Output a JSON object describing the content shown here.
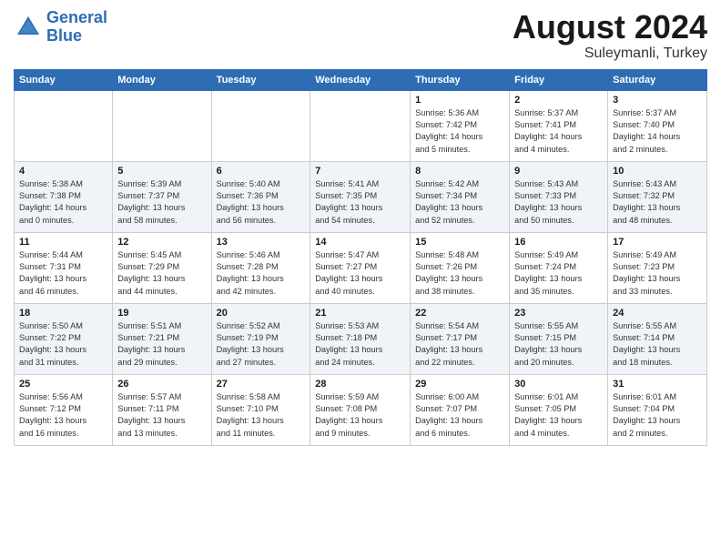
{
  "logo": {
    "line1": "General",
    "line2": "Blue"
  },
  "title": "August 2024",
  "subtitle": "Suleymanli, Turkey",
  "days_of_week": [
    "Sunday",
    "Monday",
    "Tuesday",
    "Wednesday",
    "Thursday",
    "Friday",
    "Saturday"
  ],
  "weeks": [
    [
      {
        "day": "",
        "info": ""
      },
      {
        "day": "",
        "info": ""
      },
      {
        "day": "",
        "info": ""
      },
      {
        "day": "",
        "info": ""
      },
      {
        "day": "1",
        "info": "Sunrise: 5:36 AM\nSunset: 7:42 PM\nDaylight: 14 hours\nand 5 minutes."
      },
      {
        "day": "2",
        "info": "Sunrise: 5:37 AM\nSunset: 7:41 PM\nDaylight: 14 hours\nand 4 minutes."
      },
      {
        "day": "3",
        "info": "Sunrise: 5:37 AM\nSunset: 7:40 PM\nDaylight: 14 hours\nand 2 minutes."
      }
    ],
    [
      {
        "day": "4",
        "info": "Sunrise: 5:38 AM\nSunset: 7:38 PM\nDaylight: 14 hours\nand 0 minutes."
      },
      {
        "day": "5",
        "info": "Sunrise: 5:39 AM\nSunset: 7:37 PM\nDaylight: 13 hours\nand 58 minutes."
      },
      {
        "day": "6",
        "info": "Sunrise: 5:40 AM\nSunset: 7:36 PM\nDaylight: 13 hours\nand 56 minutes."
      },
      {
        "day": "7",
        "info": "Sunrise: 5:41 AM\nSunset: 7:35 PM\nDaylight: 13 hours\nand 54 minutes."
      },
      {
        "day": "8",
        "info": "Sunrise: 5:42 AM\nSunset: 7:34 PM\nDaylight: 13 hours\nand 52 minutes."
      },
      {
        "day": "9",
        "info": "Sunrise: 5:43 AM\nSunset: 7:33 PM\nDaylight: 13 hours\nand 50 minutes."
      },
      {
        "day": "10",
        "info": "Sunrise: 5:43 AM\nSunset: 7:32 PM\nDaylight: 13 hours\nand 48 minutes."
      }
    ],
    [
      {
        "day": "11",
        "info": "Sunrise: 5:44 AM\nSunset: 7:31 PM\nDaylight: 13 hours\nand 46 minutes."
      },
      {
        "day": "12",
        "info": "Sunrise: 5:45 AM\nSunset: 7:29 PM\nDaylight: 13 hours\nand 44 minutes."
      },
      {
        "day": "13",
        "info": "Sunrise: 5:46 AM\nSunset: 7:28 PM\nDaylight: 13 hours\nand 42 minutes."
      },
      {
        "day": "14",
        "info": "Sunrise: 5:47 AM\nSunset: 7:27 PM\nDaylight: 13 hours\nand 40 minutes."
      },
      {
        "day": "15",
        "info": "Sunrise: 5:48 AM\nSunset: 7:26 PM\nDaylight: 13 hours\nand 38 minutes."
      },
      {
        "day": "16",
        "info": "Sunrise: 5:49 AM\nSunset: 7:24 PM\nDaylight: 13 hours\nand 35 minutes."
      },
      {
        "day": "17",
        "info": "Sunrise: 5:49 AM\nSunset: 7:23 PM\nDaylight: 13 hours\nand 33 minutes."
      }
    ],
    [
      {
        "day": "18",
        "info": "Sunrise: 5:50 AM\nSunset: 7:22 PM\nDaylight: 13 hours\nand 31 minutes."
      },
      {
        "day": "19",
        "info": "Sunrise: 5:51 AM\nSunset: 7:21 PM\nDaylight: 13 hours\nand 29 minutes."
      },
      {
        "day": "20",
        "info": "Sunrise: 5:52 AM\nSunset: 7:19 PM\nDaylight: 13 hours\nand 27 minutes."
      },
      {
        "day": "21",
        "info": "Sunrise: 5:53 AM\nSunset: 7:18 PM\nDaylight: 13 hours\nand 24 minutes."
      },
      {
        "day": "22",
        "info": "Sunrise: 5:54 AM\nSunset: 7:17 PM\nDaylight: 13 hours\nand 22 minutes."
      },
      {
        "day": "23",
        "info": "Sunrise: 5:55 AM\nSunset: 7:15 PM\nDaylight: 13 hours\nand 20 minutes."
      },
      {
        "day": "24",
        "info": "Sunrise: 5:55 AM\nSunset: 7:14 PM\nDaylight: 13 hours\nand 18 minutes."
      }
    ],
    [
      {
        "day": "25",
        "info": "Sunrise: 5:56 AM\nSunset: 7:12 PM\nDaylight: 13 hours\nand 16 minutes."
      },
      {
        "day": "26",
        "info": "Sunrise: 5:57 AM\nSunset: 7:11 PM\nDaylight: 13 hours\nand 13 minutes."
      },
      {
        "day": "27",
        "info": "Sunrise: 5:58 AM\nSunset: 7:10 PM\nDaylight: 13 hours\nand 11 minutes."
      },
      {
        "day": "28",
        "info": "Sunrise: 5:59 AM\nSunset: 7:08 PM\nDaylight: 13 hours\nand 9 minutes."
      },
      {
        "day": "29",
        "info": "Sunrise: 6:00 AM\nSunset: 7:07 PM\nDaylight: 13 hours\nand 6 minutes."
      },
      {
        "day": "30",
        "info": "Sunrise: 6:01 AM\nSunset: 7:05 PM\nDaylight: 13 hours\nand 4 minutes."
      },
      {
        "day": "31",
        "info": "Sunrise: 6:01 AM\nSunset: 7:04 PM\nDaylight: 13 hours\nand 2 minutes."
      }
    ]
  ]
}
